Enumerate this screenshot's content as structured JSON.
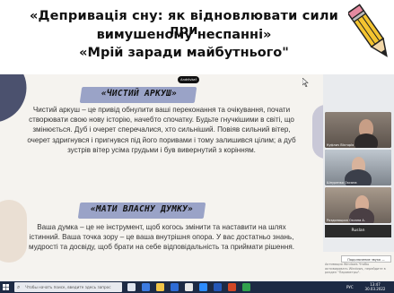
{
  "header": {
    "title_line1": "«Депривація сну: як відновлювати сили при",
    "title_line2": "вимушеному неспанні»",
    "title_line3": "«Мрій заради майбутнього\""
  },
  "slide": {
    "badge": "Andriivkaf",
    "heading1": "«ЧИСТИЙ АРКУШ»",
    "paragraph1": "Чистий аркуш – це привід обнулити ваші переконання та очікування, почати створювати свою нову історію, начебто спочатку. Будьте гнучкішими в світі, що змінюється. Дуб і очерет сперечалися, хто сильніший. Повіяв сильний вітер, очерет здригнувся і пригнувся під його поривами і тому залишився цілим; а дуб зустрів вітер усіма грудьми і був вивернутий з корінням.",
    "heading2": "«МАТИ ВЛАСНУ ДУМКУ»",
    "paragraph2": "Ваша думка – це не інструмент, щоб когось змінити та наставити на шлях істинний. Ваша точка зору – це ваша внутрішня опора. У вас достатньо знань, мудрості та досвіду, щоб брати на себе відповідальність та приймати рішення."
  },
  "video_panel": {
    "tile1_label": "Куфлич Вікторія",
    "tile2_label": "Шнуренко Оксана",
    "tile3_label": "Роздолоцька Оксана А.",
    "name_tile": "Ruslan",
    "join_label": "Подключение звука —",
    "footer_text": "Активация Windows Чтобы активировать Windows, перейдите в раздел \"Параметры\"."
  },
  "taskbar": {
    "search_placeholder": "Чтобы начать поиск, введите здесь запрос",
    "lang": "РУС",
    "time": "13:47",
    "date": "30.03.2022"
  },
  "colors": {
    "slide_bg": "#f5f3ef",
    "heading_bg": "#9aa3c7",
    "taskbar_bg": "#1d2a44"
  }
}
